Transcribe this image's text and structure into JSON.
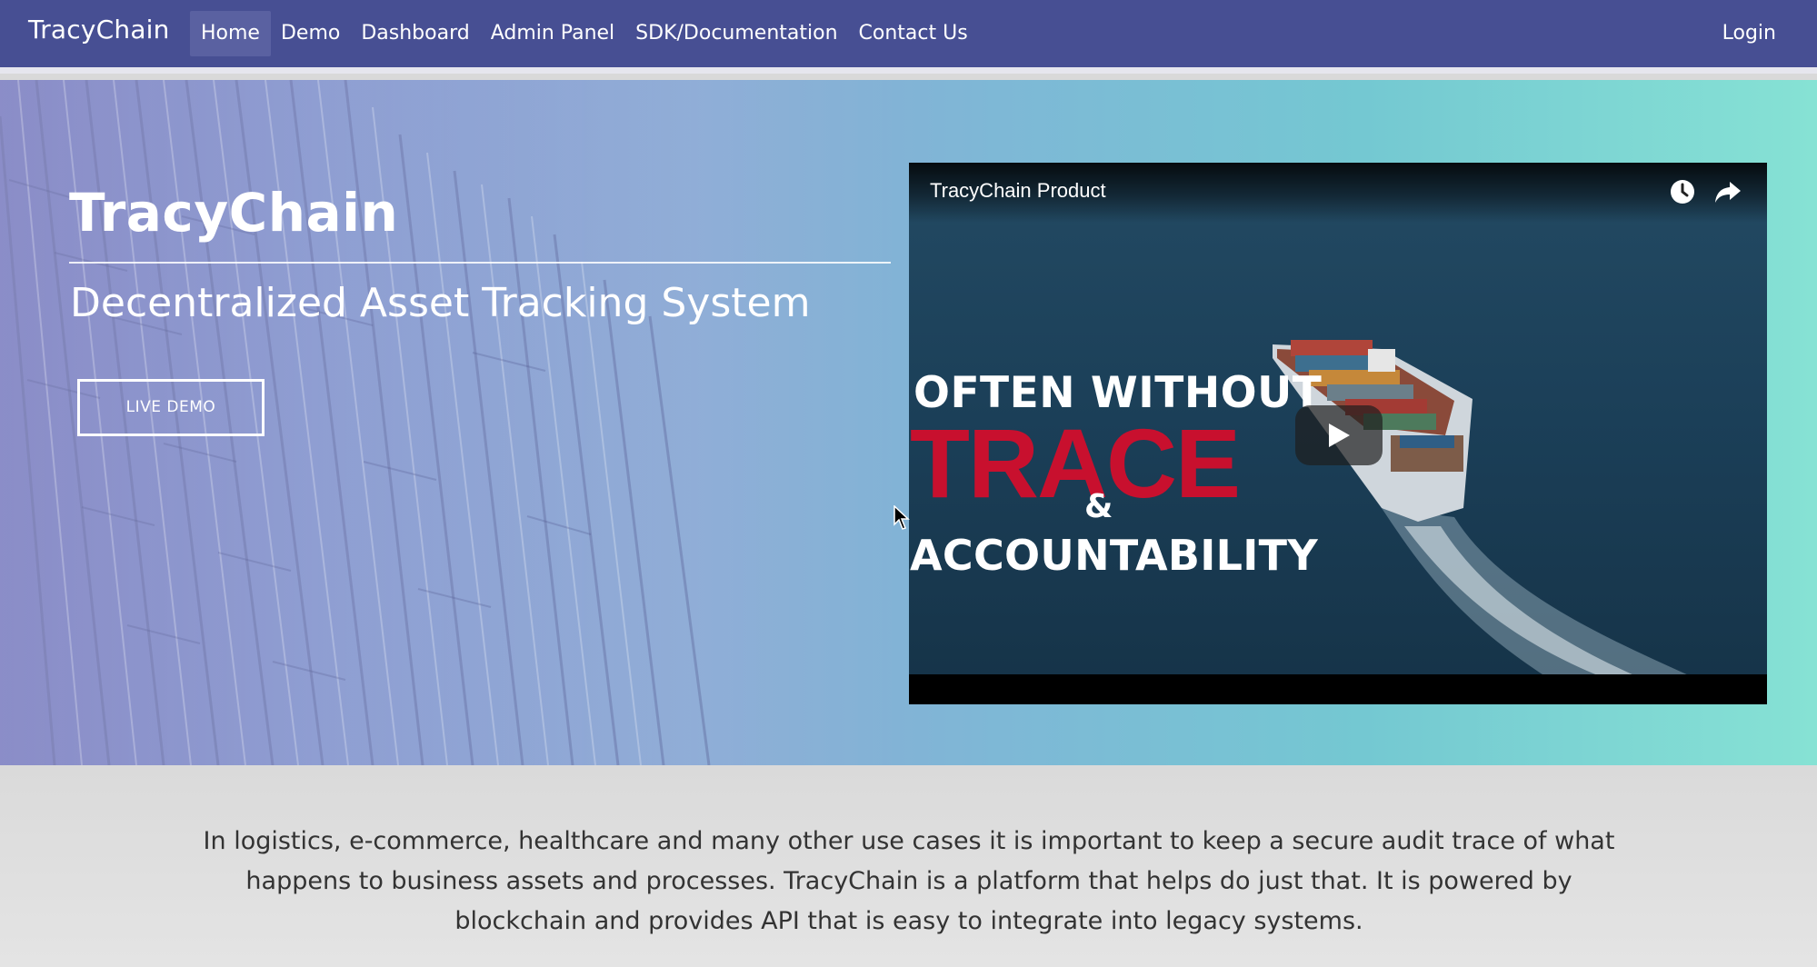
{
  "nav": {
    "brand": "TracyChain",
    "links": [
      "Home",
      "Demo",
      "Dashboard",
      "Admin Panel",
      "SDK/Documentation",
      "Contact Us"
    ],
    "login": "Login"
  },
  "hero": {
    "title": "TracyChain",
    "subtitle": "Decentralized Asset Tracking System",
    "cta": "LIVE DEMO"
  },
  "video": {
    "title": "TracyChain Product",
    "overlay_lines": [
      "OFTEN WITHOUT",
      "TRACE",
      "&",
      "ACCOUNTABILITY"
    ]
  },
  "about": {
    "text": "In logistics, e-commerce, healthcare and many other use cases it is important to keep a secure audit trace of what happens to business assets and processes. TracyChain is a platform that helps do just that. It is powered by blockchain and provides API that is easy to integrate into legacy systems."
  },
  "colors": {
    "navbar": "#474f93",
    "trace_red": "#c8102e",
    "about_bg": "#dadada"
  },
  "icons": [
    "clock-icon",
    "share-icon",
    "play-icon",
    "cursor-icon"
  ]
}
